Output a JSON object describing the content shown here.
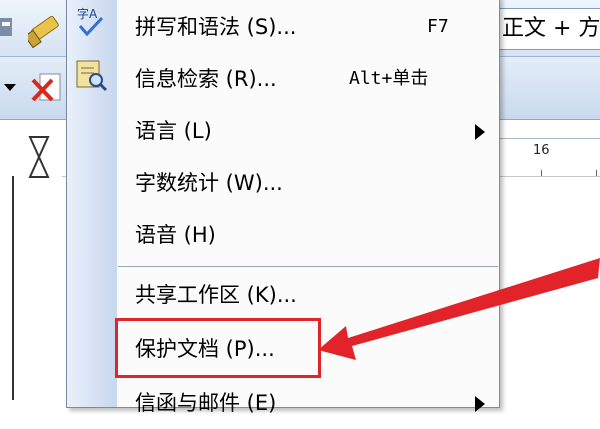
{
  "style_box": {
    "text": "正文 + 方"
  },
  "ruler": {
    "number": "16"
  },
  "menu": {
    "items": [
      {
        "label": "拼写和语法 (S)...",
        "shortcut": "F7",
        "has_icon": "spellcheck-icon"
      },
      {
        "label": "信息检索 (R)...",
        "shortcut": "Alt+单击",
        "has_icon": "research-icon"
      },
      {
        "label": "语言 (L)",
        "shortcut": "",
        "submenu": true
      },
      {
        "label": "字数统计 (W)...",
        "shortcut": ""
      },
      {
        "label": "语音 (H)",
        "shortcut": ""
      },
      {
        "label": "共享工作区 (K)...",
        "shortcut": ""
      },
      {
        "label": "保护文档 (P)...",
        "shortcut": "",
        "highlighted": true
      },
      {
        "label": "信函与邮件 (E)",
        "shortcut": "",
        "submenu": true
      }
    ]
  },
  "colors": {
    "highlight": "#e2232a",
    "menu_gutter": "#c7d7ee"
  }
}
